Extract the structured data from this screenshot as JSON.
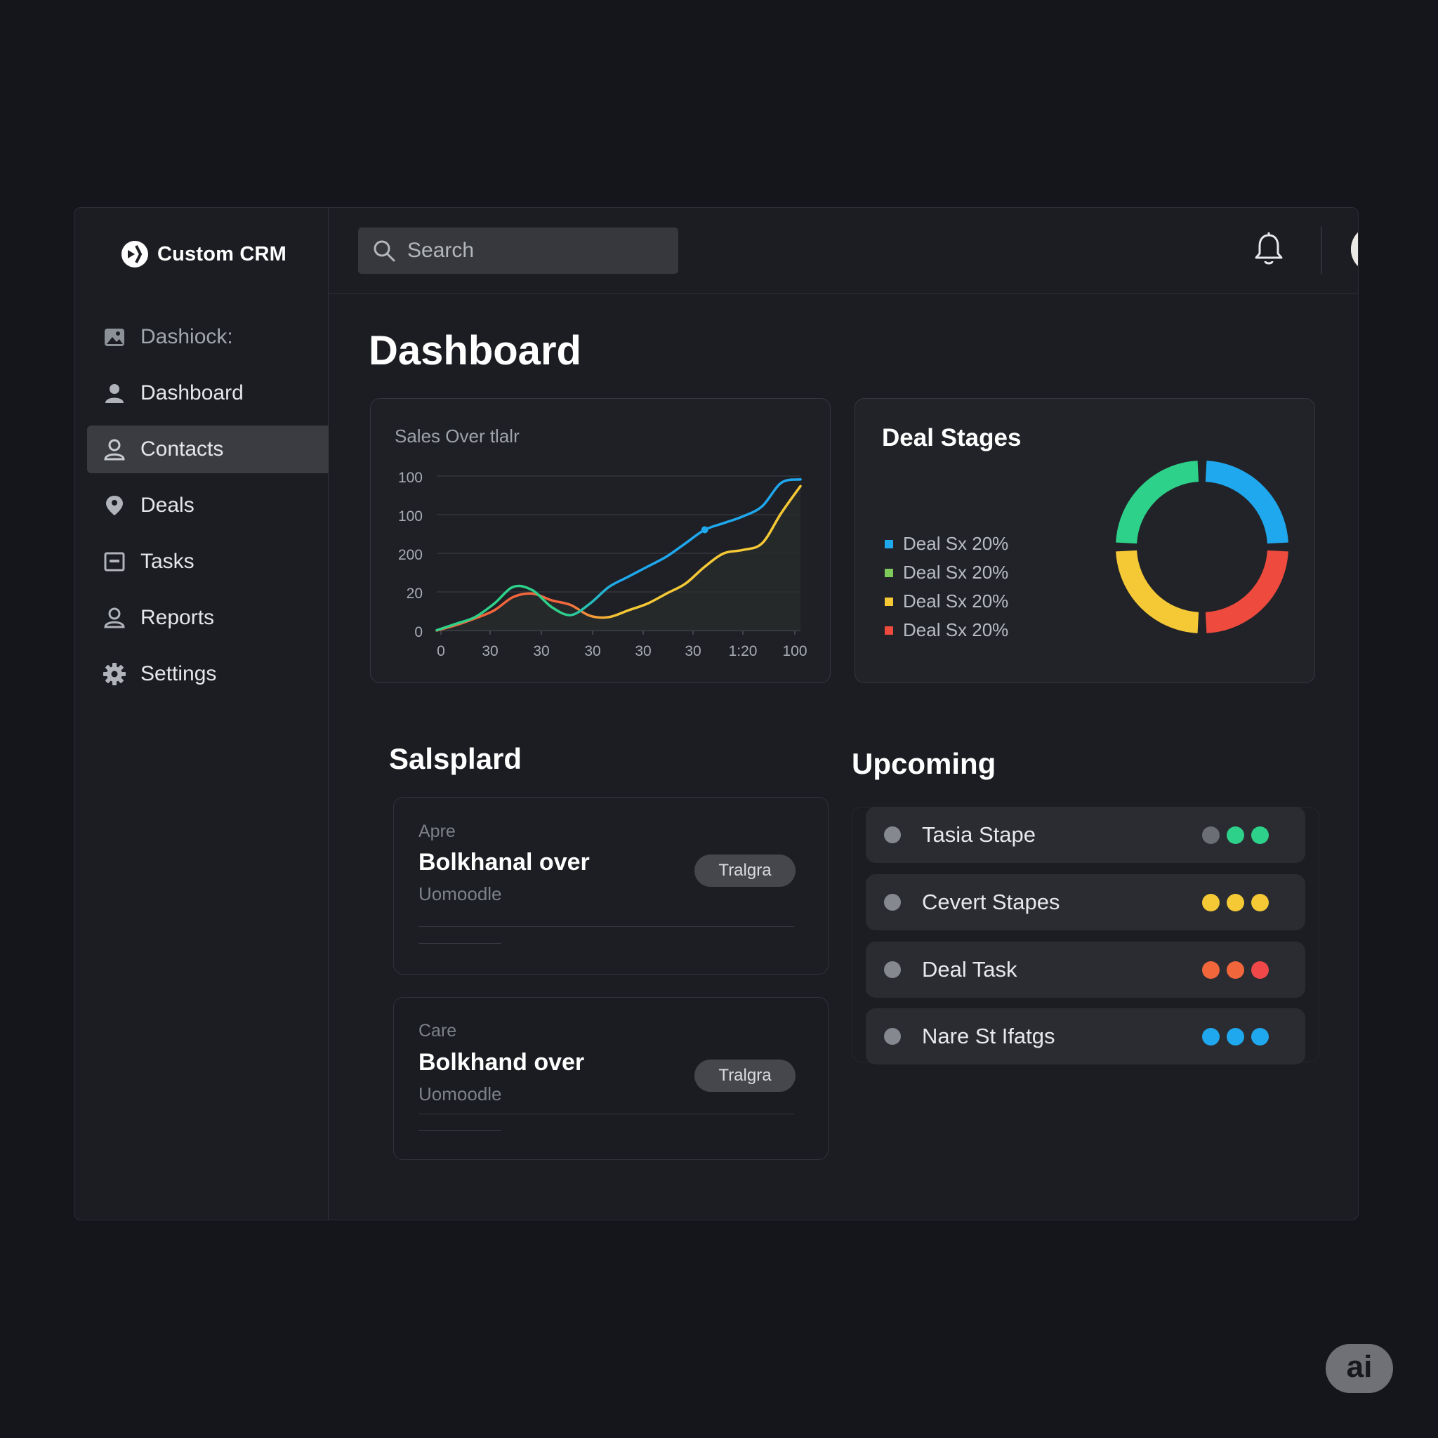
{
  "app": {
    "name": "Custom CRM"
  },
  "sidebar": {
    "items": [
      {
        "label": "Dashiock:",
        "icon": "image-icon",
        "muted": true
      },
      {
        "label": "Dashboard",
        "icon": "user-icon"
      },
      {
        "label": "Contacts",
        "icon": "contact-icon",
        "active": true
      },
      {
        "label": "Deals",
        "icon": "location-pin-icon"
      },
      {
        "label": "Tasks",
        "icon": "task-box-icon"
      },
      {
        "label": "Reports",
        "icon": "users-icon"
      },
      {
        "label": "Settings",
        "icon": "gear-icon"
      }
    ]
  },
  "topbar": {
    "search_placeholder": "Search",
    "icons": [
      "search-icon",
      "bell-icon",
      "avatar"
    ]
  },
  "page": {
    "title": "Dashboard"
  },
  "sales_chart": {
    "title": "Sales Over tlalr"
  },
  "deal_stages": {
    "title": "Deal Stages",
    "legend": [
      {
        "label": "Deal Sx 20%",
        "color": "#1fa8ee"
      },
      {
        "label": "Deal Sx 20%",
        "color": "#7dc95a"
      },
      {
        "label": "Deal Sx 20%",
        "color": "#f5c935"
      },
      {
        "label": "Deal Sx 20%",
        "color": "#ee4a3e"
      }
    ]
  },
  "salespipeline": {
    "title": "Salsplard",
    "cards": [
      {
        "eyebrow": "Apre",
        "title": "Bolkhanal over",
        "subtitle": "Uomoodle",
        "pill": "Tralgra"
      },
      {
        "eyebrow": "Care",
        "title": "Bolkhand over",
        "subtitle": "Uomoodle",
        "pill": "Tralgra"
      }
    ]
  },
  "upcoming": {
    "title": "Upcoming",
    "items": [
      {
        "label": "Tasia Stape",
        "dots": [
          "#6b6e74",
          "#2ed18a",
          "#2ed18a"
        ]
      },
      {
        "label": "Cevert Stapes",
        "dots": [
          "#f5c935",
          "#f5c935",
          "#f5c935"
        ]
      },
      {
        "label": "Deal Task",
        "dots": [
          "#f2663c",
          "#f2663c",
          "#f04848"
        ]
      },
      {
        "label": "Nare St Ifatgs",
        "dots": [
          "#1fa8ee",
          "#1fa8ee",
          "#1fa8ee"
        ]
      }
    ]
  },
  "badge": {
    "label": "ai"
  },
  "chart_data": [
    {
      "type": "line",
      "title": "Sales Over tlalr",
      "y_tick_labels": [
        "100",
        "100",
        "200",
        "20",
        "0"
      ],
      "x_tick_labels": [
        "0",
        "30",
        "30",
        "30",
        "30",
        "30",
        "1:20",
        "100"
      ],
      "grid": true,
      "legend": "none",
      "series": [
        {
          "color": "#1fa8ee",
          "values": [
            0.5,
            10,
            20,
            40,
            65,
            60,
            35,
            23,
            40,
            65,
            80,
            95,
            110,
            130,
            150,
            160,
            170,
            185,
            220,
            225
          ]
        },
        {
          "color": "#2ed18a",
          "values": [
            0.5,
            10,
            20,
            40,
            65,
            60,
            35,
            23,
            40,
            65,
            80,
            95,
            110,
            130,
            150,
            160,
            170,
            185,
            220,
            225
          ]
        },
        {
          "color": "#f2663c",
          "values": [
            0,
            8,
            18,
            30,
            50,
            55,
            45,
            38,
            22,
            20,
            30,
            40,
            55,
            70,
            95,
            115,
            120,
            130,
            175,
            215
          ]
        },
        {
          "color": "#f5c935",
          "values": [
            0,
            8,
            18,
            30,
            50,
            55,
            45,
            38,
            22,
            20,
            30,
            40,
            55,
            70,
            95,
            115,
            120,
            130,
            175,
            215
          ]
        }
      ]
    },
    {
      "type": "pie",
      "title": "Deal Stages",
      "slices": [
        {
          "label": "Deal Sx 20%",
          "value": 20,
          "color": "#1fa8ee"
        },
        {
          "label": "Deal Sx 20%",
          "value": 20,
          "color": "#7dc95a"
        },
        {
          "label": "Deal Sx 20%",
          "value": 20,
          "color": "#f5c935"
        },
        {
          "label": "Deal Sx 20%",
          "value": 20,
          "color": "#ee4a3e"
        }
      ]
    }
  ]
}
